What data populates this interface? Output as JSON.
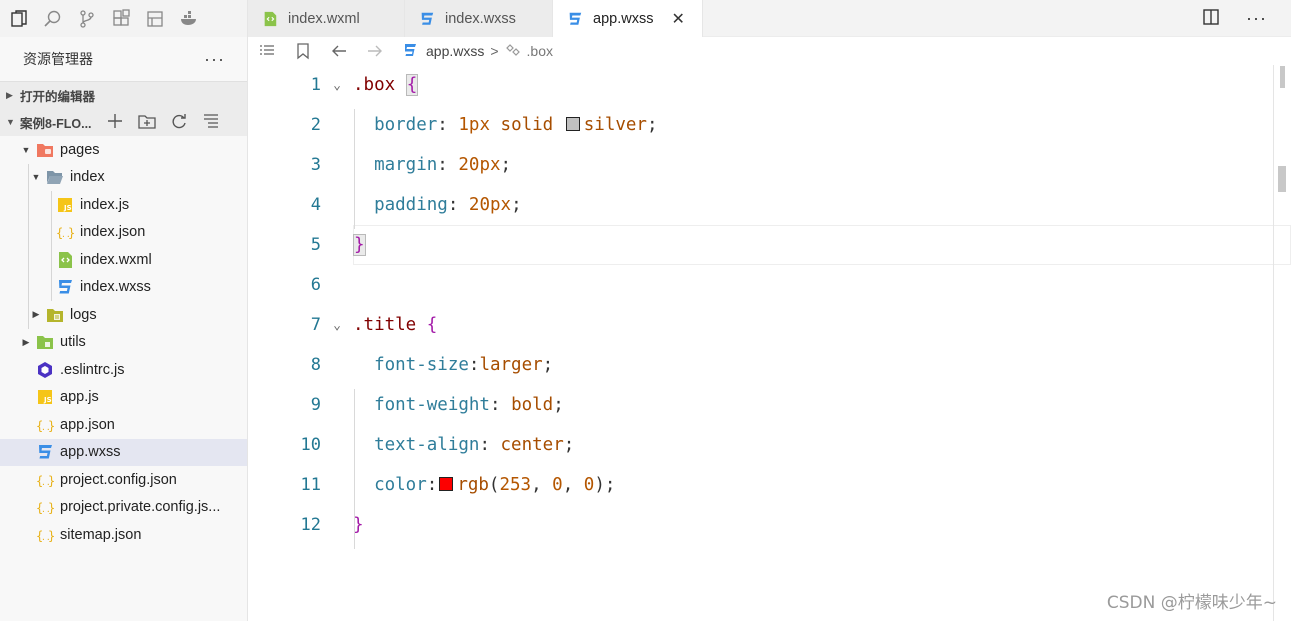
{
  "toolbar": {
    "icons": [
      "explorer-icon",
      "search-icon",
      "source-control-icon",
      "extensions-icon",
      "debug-icon",
      "docker-icon"
    ]
  },
  "sidebar": {
    "title": "资源管理器",
    "more": "···",
    "open_editors": "打开的编辑器",
    "project": "案例8-FLO...",
    "tree": [
      {
        "label": "pages",
        "icon": "pages-folder-icon",
        "indent": 0,
        "arrow": "▼"
      },
      {
        "label": "index",
        "icon": "folder-open-icon",
        "indent": 1,
        "arrow": "▼"
      },
      {
        "label": "index.js",
        "icon": "js-file-icon",
        "indent": 2,
        "arrow": ""
      },
      {
        "label": "index.json",
        "icon": "json-file-icon",
        "indent": 2,
        "arrow": ""
      },
      {
        "label": "index.wxml",
        "icon": "wxml-file-icon",
        "indent": 2,
        "arrow": ""
      },
      {
        "label": "index.wxss",
        "icon": "wxss-file-icon",
        "indent": 2,
        "arrow": ""
      },
      {
        "label": "logs",
        "icon": "logs-folder-icon",
        "indent": 1,
        "arrow": "▶"
      },
      {
        "label": "utils",
        "icon": "utils-folder-icon",
        "indent": 0,
        "arrow": "▶"
      },
      {
        "label": ".eslintrc.js",
        "icon": "eslint-file-icon",
        "indent": 0,
        "arrow": ""
      },
      {
        "label": "app.js",
        "icon": "js-file-icon",
        "indent": 0,
        "arrow": ""
      },
      {
        "label": "app.json",
        "icon": "json-file-icon",
        "indent": 0,
        "arrow": ""
      },
      {
        "label": "app.wxss",
        "icon": "wxss-file-icon",
        "indent": 0,
        "arrow": "",
        "selected": true
      },
      {
        "label": "project.config.json",
        "icon": "json-file-icon",
        "indent": 0,
        "arrow": ""
      },
      {
        "label": "project.private.config.js...",
        "icon": "json-file-icon",
        "indent": 0,
        "arrow": ""
      },
      {
        "label": "sitemap.json",
        "icon": "json-file-icon",
        "indent": 0,
        "arrow": ""
      }
    ]
  },
  "tabs": [
    {
      "label": "index.wxml",
      "icon": "wxml-file-icon",
      "active": false
    },
    {
      "label": "index.wxss",
      "icon": "wxss-file-icon",
      "active": false
    },
    {
      "label": "app.wxss",
      "icon": "wxss-file-icon",
      "active": true,
      "close": "✕"
    }
  ],
  "breadcrumb": {
    "file": "app.wxss",
    "separator": ">",
    "symbol": ".box"
  },
  "editor": {
    "line_numbers": [
      "1",
      "2",
      "3",
      "4",
      "5",
      "6",
      "7",
      "8",
      "9",
      "10",
      "11",
      "12"
    ],
    "lines": [
      {
        "fold": "⌄",
        "tokens": [
          [
            "sel",
            ".box "
          ],
          [
            "brace brace-box",
            "{"
          ]
        ]
      },
      {
        "fold": "",
        "tokens": [
          [
            "ind",
            "  "
          ],
          [
            "pn",
            "border"
          ],
          [
            "pun",
            ": "
          ],
          [
            "num",
            "1px "
          ],
          [
            "val",
            "solid "
          ],
          [
            "swatch",
            "#c0c0c0"
          ],
          [
            "val",
            "silver"
          ],
          [
            "pun",
            ";"
          ]
        ]
      },
      {
        "fold": "",
        "tokens": [
          [
            "ind",
            "  "
          ],
          [
            "pn",
            "margin"
          ],
          [
            "pun",
            ": "
          ],
          [
            "num",
            "20px"
          ],
          [
            "pun",
            ";"
          ]
        ]
      },
      {
        "fold": "",
        "tokens": [
          [
            "ind",
            "  "
          ],
          [
            "pn",
            "padding"
          ],
          [
            "pun",
            ": "
          ],
          [
            "num",
            "20px"
          ],
          [
            "pun",
            ";"
          ]
        ]
      },
      {
        "fold": "",
        "tokens": [
          [
            "brace brace-box",
            "}"
          ]
        ]
      },
      {
        "fold": "",
        "tokens": []
      },
      {
        "fold": "⌄",
        "tokens": [
          [
            "sel",
            ".title "
          ],
          [
            "brace",
            "{"
          ]
        ]
      },
      {
        "fold": "",
        "tokens": [
          [
            "ind",
            "  "
          ],
          [
            "pn",
            "font-size"
          ],
          [
            "pun",
            ":"
          ],
          [
            "val",
            "larger"
          ],
          [
            "pun",
            ";"
          ]
        ]
      },
      {
        "fold": "",
        "tokens": [
          [
            "ind",
            "  "
          ],
          [
            "pn",
            "font-weight"
          ],
          [
            "pun",
            ": "
          ],
          [
            "val",
            "bold"
          ],
          [
            "pun",
            ";"
          ]
        ]
      },
      {
        "fold": "",
        "tokens": [
          [
            "ind",
            "  "
          ],
          [
            "pn",
            "text-align"
          ],
          [
            "pun",
            ": "
          ],
          [
            "val",
            "center"
          ],
          [
            "pun",
            ";"
          ]
        ]
      },
      {
        "fold": "",
        "tokens": [
          [
            "ind",
            "  "
          ],
          [
            "pn",
            "color"
          ],
          [
            "pun",
            ":"
          ],
          [
            "swatch",
            "#fd0000"
          ],
          [
            "val",
            "rgb"
          ],
          [
            "pun",
            "("
          ],
          [
            "num",
            "253"
          ],
          [
            "pun",
            ", "
          ],
          [
            "num",
            "0"
          ],
          [
            "pun",
            ", "
          ],
          [
            "num",
            "0"
          ],
          [
            "pun",
            ");"
          ]
        ]
      },
      {
        "fold": "",
        "tokens": [
          [
            "brace",
            "}"
          ]
        ]
      }
    ]
  },
  "watermark": "CSDN @柠檬味少年~"
}
